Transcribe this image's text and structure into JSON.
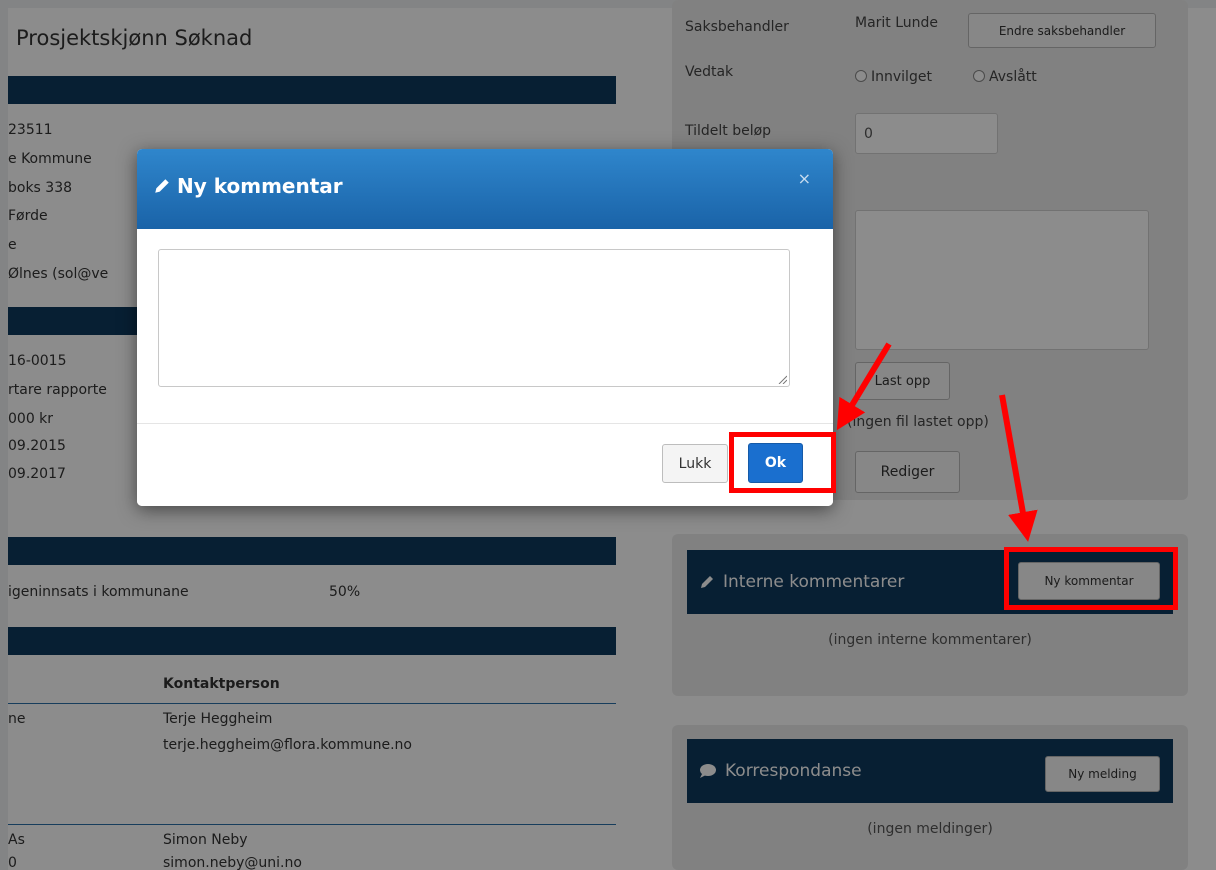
{
  "page": {
    "title": "Prosjektskjønn Søknad"
  },
  "applicant": {
    "org_number": "23511",
    "name": "e Kommune",
    "address": "boks 338",
    "city": "Førde",
    "line5": "e",
    "contact": "Ølnes (sol@ve"
  },
  "project": {
    "case_no": "16-0015",
    "title": "rtare rapporte",
    "amount": "000 kr",
    "start": "09.2015",
    "end": "09.2017"
  },
  "effort": {
    "label": "igeninnsats i kommunane",
    "percent": "50%"
  },
  "partners": {
    "header_contact": "Kontaktperson",
    "rows": [
      {
        "org": "ne",
        "person": "Terje Heggheim",
        "email": "terje.heggheim@flora.kommune.no"
      },
      {
        "org": "As",
        "org2": "0",
        "person": "Simon Neby",
        "email": "simon.neby@uni.no"
      }
    ]
  },
  "sidebar": {
    "saksbehandler_label": "Saksbehandler",
    "saksbehandler_value": "Marit Lunde",
    "change_button": "Endre saksbehandler",
    "vedtak_label": "Vedtak",
    "radio_innvilget": "Innvilget",
    "radio_avslatt": "Avslått",
    "tildelt_label": "Tildelt beløp",
    "tildelt_value": "0",
    "upload_button": "Last opp",
    "no_file": "(ingen fil lastet opp)",
    "edit_button": "Rediger"
  },
  "internal_comments": {
    "title": "Interne kommentarer",
    "new_button": "Ny kommentar",
    "empty": "(ingen interne kommentarer)"
  },
  "correspondence": {
    "title": "Korrespondanse",
    "new_button": "Ny melding",
    "empty": "(ingen meldinger)"
  },
  "modal": {
    "title": "Ny kommentar",
    "close": "×",
    "cancel_button": "Lukk",
    "ok_button": "Ok"
  },
  "colors": {
    "header_band": "#0e3a5e",
    "modal_header": "#2378bf",
    "ok_button": "#1a6fcf",
    "annotation": "#ff0000"
  },
  "icons": [
    "pencil-icon",
    "chat-bubble-icon",
    "close-icon",
    "resize-grip-icon"
  ]
}
